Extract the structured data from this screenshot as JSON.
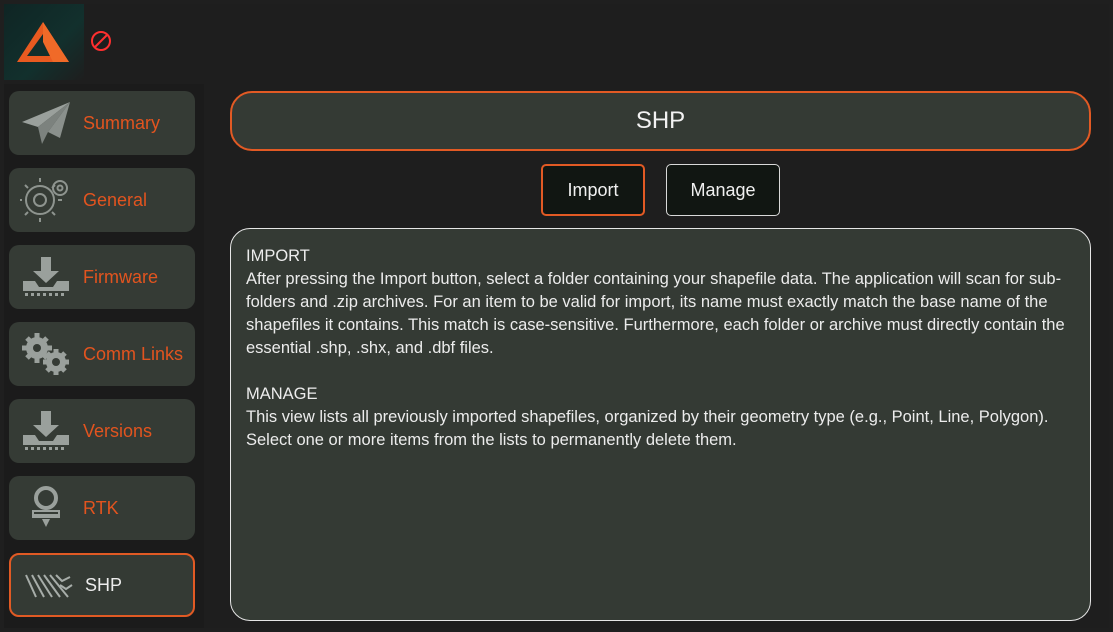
{
  "app": {
    "logo": "triangle-logo-icon",
    "status_icon": "no-entry-icon",
    "accent_color": "#e25a24",
    "panel_color": "#343a34"
  },
  "sidebar": {
    "items": [
      {
        "label": "Summary",
        "icon": "paper-plane-icon",
        "active": false
      },
      {
        "label": "General",
        "icon": "gear-icon",
        "active": false
      },
      {
        "label": "Firmware",
        "icon": "download-tray-icon",
        "active": false
      },
      {
        "label": "Comm Links",
        "icon": "gears-icon",
        "active": false
      },
      {
        "label": "Versions",
        "icon": "download-tray-icon",
        "active": false
      },
      {
        "label": "RTK",
        "icon": "rtk-antenna-icon",
        "active": false
      },
      {
        "label": "SHP",
        "icon": "field-rows-icon",
        "active": true
      }
    ]
  },
  "main": {
    "title": "SHP",
    "buttons": {
      "import_label": "Import",
      "manage_label": "Manage"
    },
    "info": {
      "import_heading": "IMPORT",
      "import_text": "After pressing the Import button, select a folder containing your shapefile data. The application will scan for sub-folders and .zip archives. For an item to be valid for import, its name must exactly match the base name of the shapefiles it contains. This match is case-sensitive. Furthermore, each folder or archive must directly contain the essential .shp, .shx, and .dbf files.",
      "manage_heading": "MANAGE",
      "manage_text": "This view lists all previously imported shapefiles, organized by their geometry type (e.g., Point, Line, Polygon). Select one or more items from the lists to permanently delete them."
    }
  }
}
